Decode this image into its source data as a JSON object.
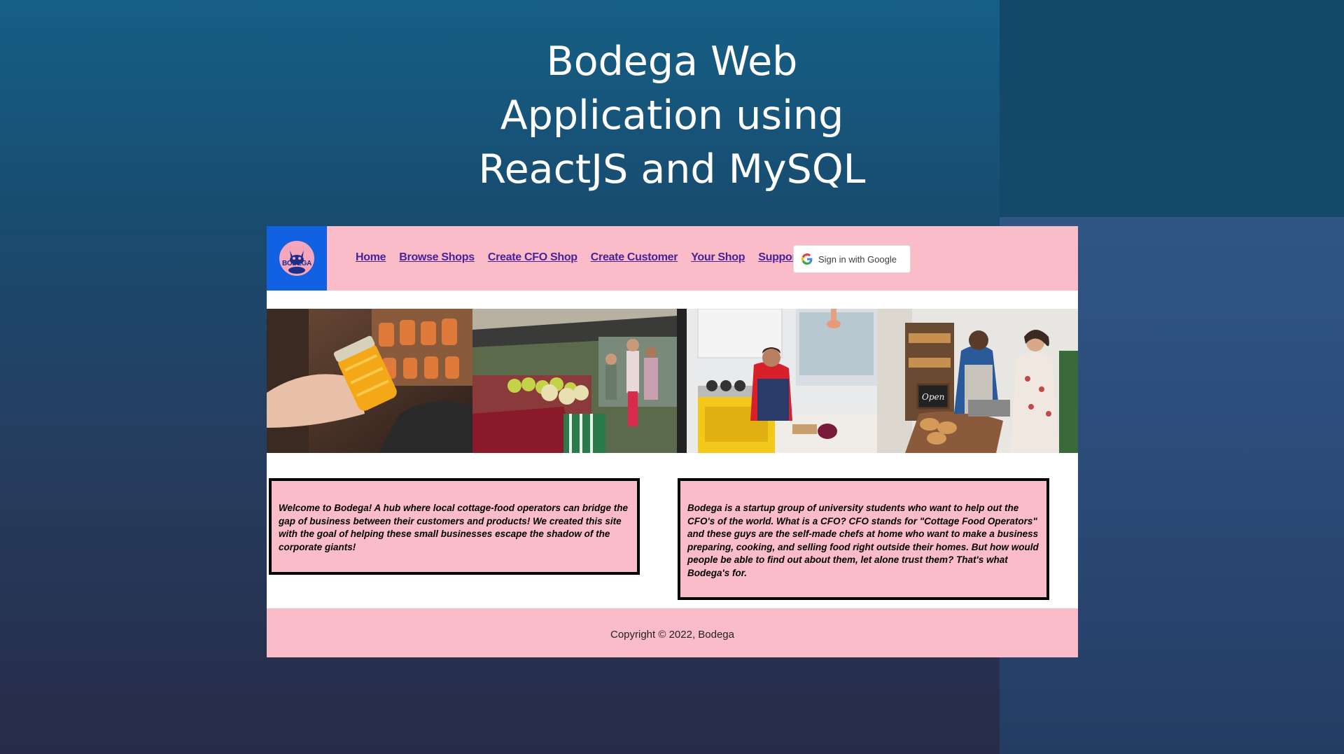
{
  "slide": {
    "title_lines": [
      "Bodega Web",
      "Application using",
      "ReactJS and MySQL"
    ]
  },
  "app": {
    "logo_text": "BODEGA",
    "nav": {
      "items": [
        "Home",
        "Browse Shops",
        "Create CFO Shop",
        "Create Customer",
        "Your Shop",
        "Support"
      ]
    },
    "google_button": {
      "label": "Sign in with Google"
    },
    "hero_images": [
      "honey-jar-photo",
      "farmers-market-photo",
      "kitchen-cooking-photo",
      "bakery-shop-photo"
    ],
    "intro_text": "Welcome to Bodega! A hub where local cottage-food operators can bridge the gap of business between their customers and products! We created this site with the goal of helping these small businesses escape the shadow of the corporate giants!",
    "about_text": "Bodega is a startup group of university students who want to help out the CFO's of the world. What is a CFO? CFO stands for \"Cottage Food Operators\" and these guys are the self-made chefs at home who want to make a business preparing, cooking, and selling food right outside their homes. But how would people be able to find out about them, let alone trust them? That's what Bodega's for.",
    "footer": "Copyright © 2022, Bodega"
  },
  "colors": {
    "navbar_pink": "#fbbcc9",
    "logo_blue": "#1261e3",
    "link_purple": "#4b2196"
  }
}
